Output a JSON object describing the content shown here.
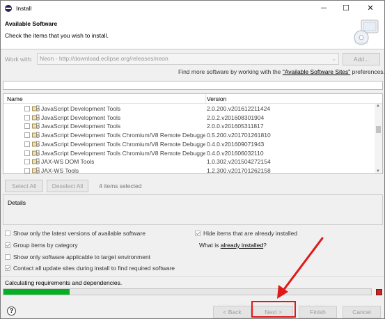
{
  "window": {
    "title": "Install",
    "minimize": "─",
    "maximize": "☐",
    "close": "✕"
  },
  "banner": {
    "title": "Available Software",
    "subtitle": "Check the items that you wish to install."
  },
  "work_with": {
    "label": "Work with:",
    "value": "Neon - http://download.eclipse.org/releases/neon",
    "add_label": "Add...",
    "find_more_prefix": "Find more software by working with the ",
    "find_more_link": "\"Available Software Sites\"",
    "find_more_suffix": " preferences."
  },
  "table": {
    "col_name": "Name",
    "col_version": "Version",
    "rows": [
      {
        "name": "JavaScript Development Tools",
        "version": "2.0.200.v201612211424"
      },
      {
        "name": "JavaScript Development Tools",
        "version": "2.0.2.v201608301904"
      },
      {
        "name": "JavaScript Development Tools",
        "version": "2.0.0.v201605311817"
      },
      {
        "name": "JavaScript Development Tools Chromium/V8 Remote Debugger",
        "version": "0.5.200.v201701261810"
      },
      {
        "name": "JavaScript Development Tools Chromium/V8 Remote Debugger",
        "version": "0.4.0.v201609071943"
      },
      {
        "name": "JavaScript Development Tools Chromium/V8 Remote Debugger",
        "version": "0.4.0.v201606032110"
      },
      {
        "name": "JAX-WS DOM Tools",
        "version": "1.0.302.v201504272154"
      },
      {
        "name": "JAX-WS Tools",
        "version": "1.2.300.v201701262158"
      }
    ]
  },
  "selection": {
    "select_all": "Select All",
    "deselect_all": "Deselect All",
    "count": "4 items selected"
  },
  "details": {
    "label": "Details"
  },
  "options": {
    "latest_only": "Show only the latest versions of available software",
    "group_by_category": "Group items by category",
    "target_env": "Show only software applicable to target environment",
    "contact_sites": "Contact all update sites during install to find required software",
    "hide_installed": "Hide items that are already installed",
    "what_is_prefix": "What is ",
    "what_is_link": "already installed",
    "what_is_suffix": "?"
  },
  "status": {
    "text": "Calculating requirements and dependencies.",
    "progress": 0.18
  },
  "buttons": {
    "back": "< Back",
    "next": "Next >",
    "finish": "Finish",
    "cancel": "Cancel",
    "help": "?"
  },
  "watermark": "https://blog.csdn.net/Glover_polu",
  "colors": {
    "annotation": "#e01818",
    "progress": "#06b025"
  }
}
